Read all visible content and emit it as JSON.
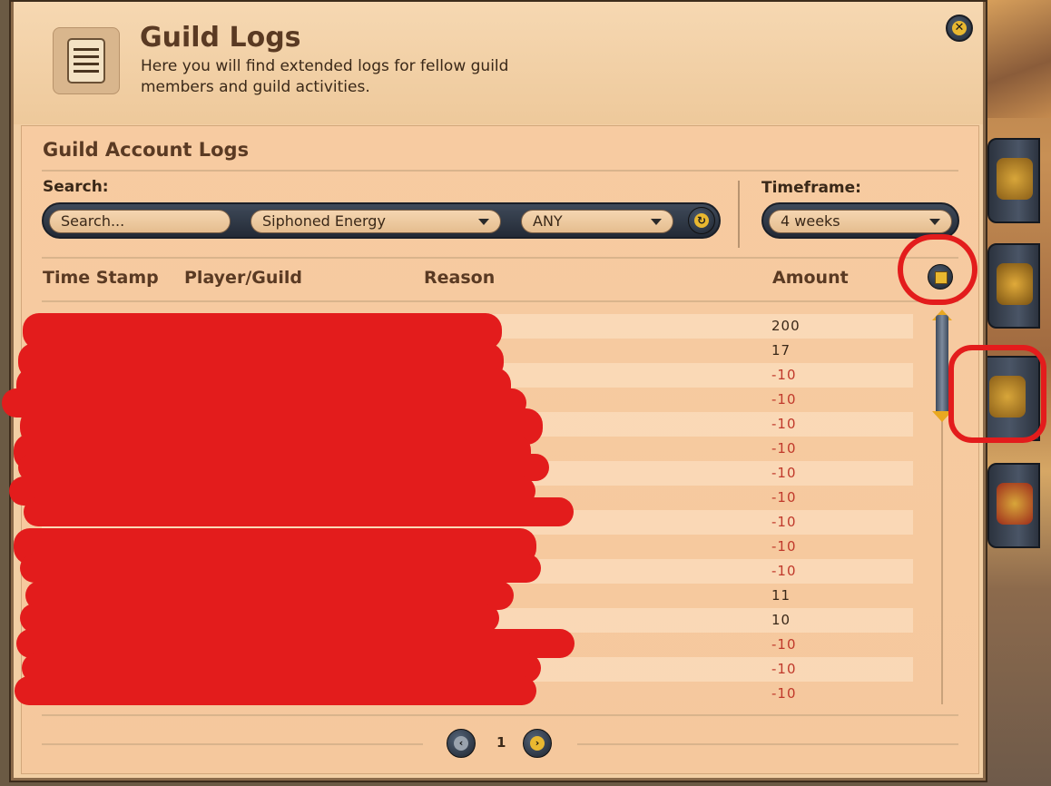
{
  "window": {
    "title": "Guild Logs",
    "subtitle": "Here you will find extended logs for fellow guild members and guild activities.",
    "close_icon": "close-icon"
  },
  "panel": {
    "section_title": "Guild Account Logs",
    "search_label": "Search:",
    "search_placeholder": "Search...",
    "reason_filter": "Siphoned Energy",
    "type_filter": "ANY",
    "timeframe_label": "Timeframe:",
    "timeframe_value": "4 weeks"
  },
  "table": {
    "columns": [
      "Time Stamp",
      "Player/Guild",
      "Reason",
      "Amount"
    ],
    "amounts": [
      "200",
      "17",
      "-10",
      "-10",
      "-10",
      "-10",
      "-10",
      "-10",
      "-10",
      "-10",
      "-10",
      "11",
      "10",
      "-10",
      "-10",
      "-10"
    ]
  },
  "pager": {
    "current_page": "1"
  },
  "colors": {
    "positive": "#3a2818",
    "negative": "#c0392b",
    "accent": "#e9b830",
    "redaction": "#e31c1c"
  }
}
